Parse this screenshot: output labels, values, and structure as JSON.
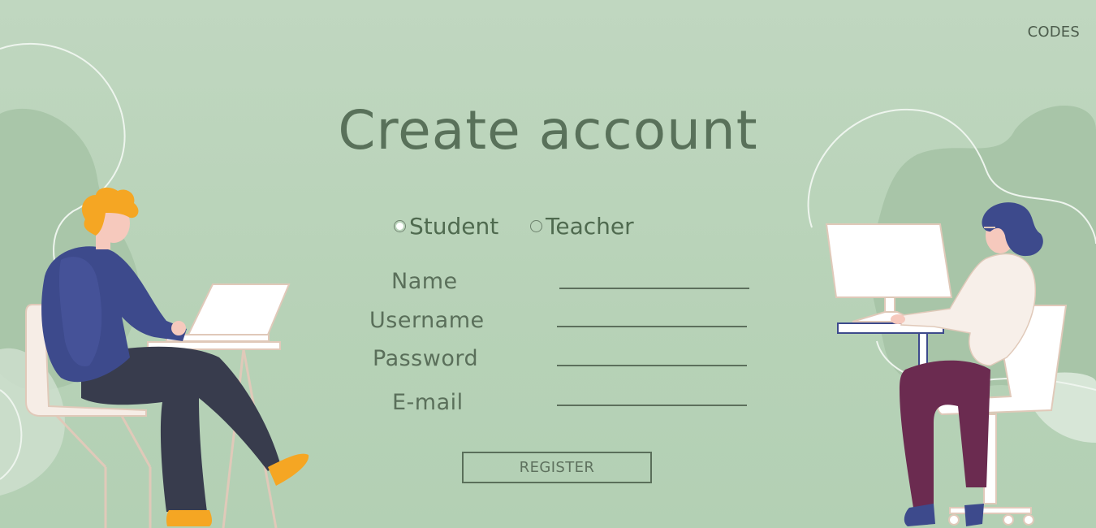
{
  "nav": {
    "codes_label": "CODES"
  },
  "form": {
    "title": "Create account",
    "roles": [
      {
        "label": "Student",
        "selected": true
      },
      {
        "label": "Teacher",
        "selected": false
      }
    ],
    "fields": {
      "name": {
        "label": "Name",
        "value": ""
      },
      "username": {
        "label": "Username",
        "value": ""
      },
      "password": {
        "label": "Password",
        "value": ""
      },
      "email": {
        "label": "E-mail",
        "value": ""
      }
    },
    "register_label": "REGISTER"
  },
  "colors": {
    "background": "#b9d4ba",
    "accent": "#59715a",
    "blob": "#a8c6a9",
    "hair_orange": "#f5a623",
    "sweater_navy": "#3d4a8c",
    "pants_maroon": "#6b2b50"
  }
}
